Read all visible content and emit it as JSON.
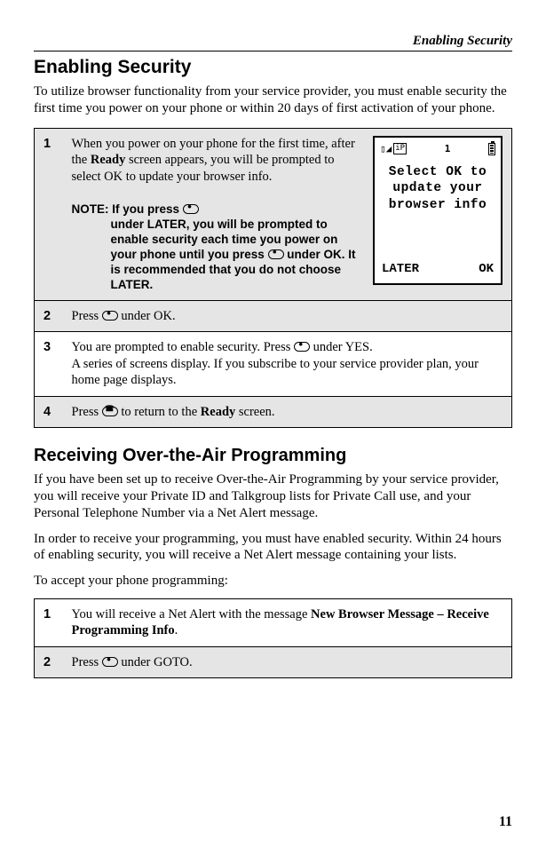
{
  "header": {
    "section": "Enabling Security"
  },
  "section1": {
    "title": "Enabling Security",
    "intro": "To utilize browser functionality from your service provider, you must enable security the first time you power on your phone or within 20 days of first activation of your phone."
  },
  "phone": {
    "line1": "Select OK to",
    "line2": "update your",
    "line3": "browser info",
    "btn_left": "LATER",
    "btn_right": "OK",
    "status_sig": "1"
  },
  "steps1": {
    "r1": {
      "num": "1",
      "text_a": "When you power on your phone for the first time, after the ",
      "text_b": "Ready",
      "text_c": " screen appears, you will be prompted to select OK to update your browser info.",
      "note_label": "NOTE: ",
      "note_a": "If you press ",
      "note_b": " under LATER, you will be prompted to enable security each time you power on your phone until you press ",
      "note_c": " under OK. It is recommended that you do not choose LATER."
    },
    "r2": {
      "num": "2",
      "text_a": "Press ",
      "text_b": " under OK."
    },
    "r3": {
      "num": "3",
      "text_a": "You are prompted to enable security. Press ",
      "text_b": " under YES.",
      "text_c": "A series of screens display. If you subscribe to your service provider plan, your home page displays."
    },
    "r4": {
      "num": "4",
      "text_a": "Press ",
      "text_b": " to return to the ",
      "text_c": "Ready",
      "text_d": " screen."
    }
  },
  "section2": {
    "title": "Receiving Over-the-Air Programming",
    "p1": "If you have been set up to receive Over-the-Air Programming by your service provider, you will receive your Private ID and Talkgroup lists for Private Call use, and your Personal Telephone Number via a Net Alert message.",
    "p2": "In order to receive your programming, you must have enabled security. Within 24 hours of enabling security, you will receive a Net Alert message containing your lists.",
    "p3": "To accept your phone programming:"
  },
  "steps2": {
    "r1": {
      "num": "1",
      "text_a": "You will receive a Net Alert with the message ",
      "text_b": "New Browser Message – Receive Programming Info",
      "text_c": "."
    },
    "r2": {
      "num": "2",
      "text_a": "Press ",
      "text_b": " under GOTO."
    }
  },
  "page_number": "11"
}
